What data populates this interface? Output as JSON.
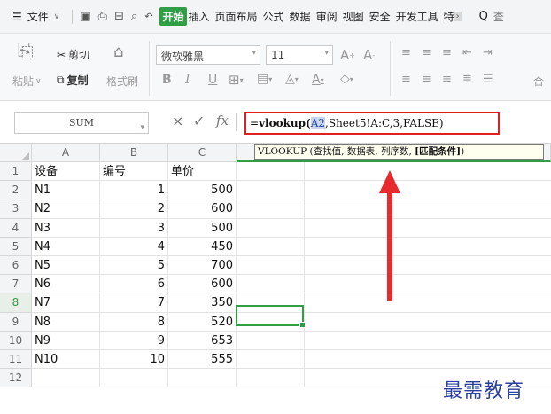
{
  "menubar": {
    "menu_icon": "hamburger-icon",
    "file_label": "文件",
    "tabs": [
      "开始",
      "插入",
      "页面布局",
      "公式",
      "数据",
      "审阅",
      "视图",
      "安全",
      "开发工具",
      "特"
    ],
    "active_tab": "开始",
    "active_tab_color": "#2f9e44"
  },
  "ribbon": {
    "paste_label": "粘贴",
    "cut_label": "剪切",
    "copy_label": "复制",
    "format_painter_label": "格式刷",
    "font_name": "微软雅黑",
    "font_size": "11",
    "bold_label": "B",
    "italic_label": "I",
    "underline_label": "U",
    "merge_label": "合"
  },
  "formula_bar": {
    "name_box": "SUM",
    "cancel_symbol": "×",
    "confirm_symbol": "✓",
    "fx_symbol": "fx",
    "formula_prefix": "=",
    "formula_fn": "vlookup",
    "formula_open": "(",
    "formula_ref": "A2",
    "formula_rest": ",Sheet5!A:C,3,FALSE)",
    "highlight_color": "#e02020"
  },
  "tooltip": {
    "text_plain": "VLOOKUP (查找值, 数据表, 列序数, ",
    "text_bold": "[匹配条件]",
    "text_close": ")"
  },
  "grid": {
    "columns": [
      "A",
      "B",
      "C"
    ],
    "rows": [
      {
        "num": "1",
        "a": "设备",
        "b": "编号",
        "c": "单价"
      },
      {
        "num": "2",
        "a": "N1",
        "b": "1",
        "c": "500"
      },
      {
        "num": "3",
        "a": "N2",
        "b": "2",
        "c": "600"
      },
      {
        "num": "4",
        "a": "N3",
        "b": "3",
        "c": "500"
      },
      {
        "num": "5",
        "a": "N4",
        "b": "4",
        "c": "450"
      },
      {
        "num": "6",
        "a": "N5",
        "b": "5",
        "c": "700"
      },
      {
        "num": "7",
        "a": "N6",
        "b": "6",
        "c": "600"
      },
      {
        "num": "8",
        "a": "N7",
        "b": "7",
        "c": "350"
      },
      {
        "num": "9",
        "a": "N8",
        "b": "8",
        "c": "520"
      },
      {
        "num": "10",
        "a": "N9",
        "b": "9",
        "c": "653"
      },
      {
        "num": "11",
        "a": "N10",
        "b": "10",
        "c": "555"
      },
      {
        "num": "12",
        "a": "",
        "b": "",
        "c": ""
      }
    ],
    "active_row": "8",
    "active_color": "#2f9e44"
  },
  "annotation": {
    "arrow_color": "#e8292d"
  },
  "watermark": "最需教育"
}
